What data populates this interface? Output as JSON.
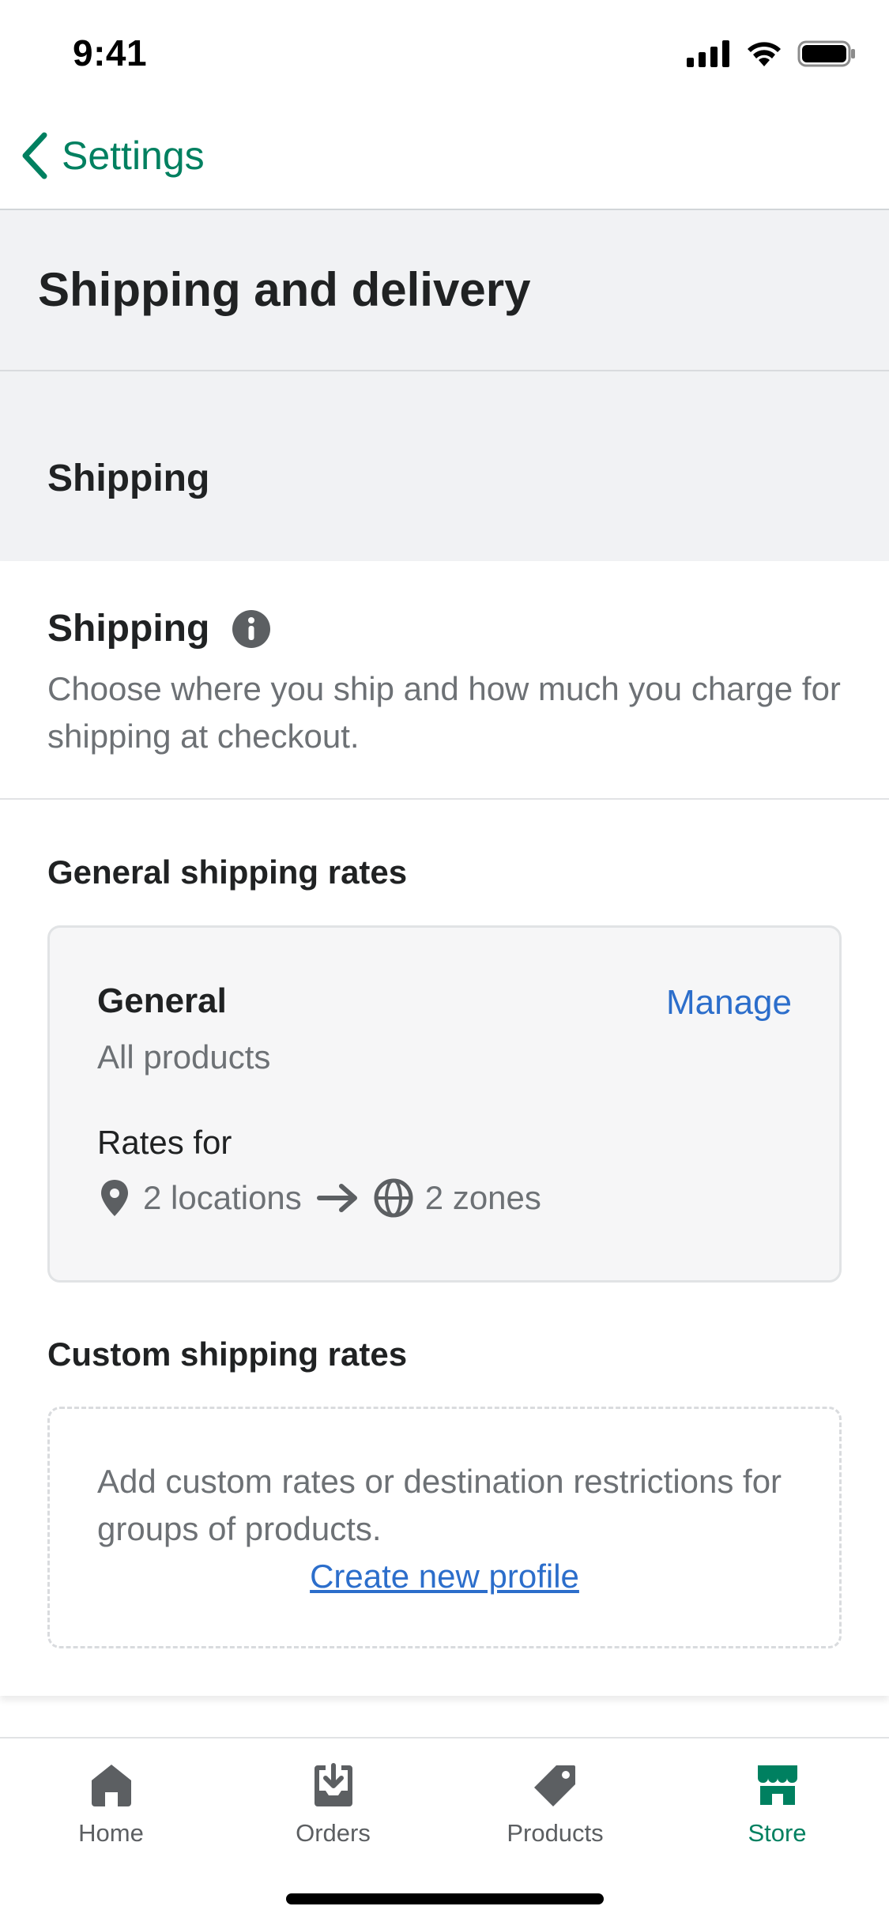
{
  "status_bar": {
    "time": "9:41"
  },
  "nav": {
    "back_label": "Settings"
  },
  "page_title": "Shipping and delivery",
  "section_title": "Shipping",
  "card": {
    "title": "Shipping",
    "description": "Choose where you ship and how much you charge for shipping at checkout."
  },
  "general_rates": {
    "heading": "General shipping rates",
    "profile_name": "General",
    "manage_label": "Manage",
    "scope": "All products",
    "rates_for_label": "Rates for",
    "locations": "2 locations",
    "zones": "2 zones"
  },
  "custom_rates": {
    "heading": "Custom shipping rates",
    "description": "Add custom rates or destination restrictions for groups of products.",
    "create_label": "Create new profile"
  },
  "tabs": [
    {
      "label": "Home",
      "icon": "home-icon"
    },
    {
      "label": "Orders",
      "icon": "orders-icon"
    },
    {
      "label": "Products",
      "icon": "tag-icon"
    },
    {
      "label": "Store",
      "icon": "store-icon",
      "active": true
    }
  ],
  "colors": {
    "accent": "#008060",
    "link": "#2c6ecb",
    "band": "#f1f2f4",
    "text_subdued": "#6d7175",
    "icon": "#5c5f62"
  }
}
